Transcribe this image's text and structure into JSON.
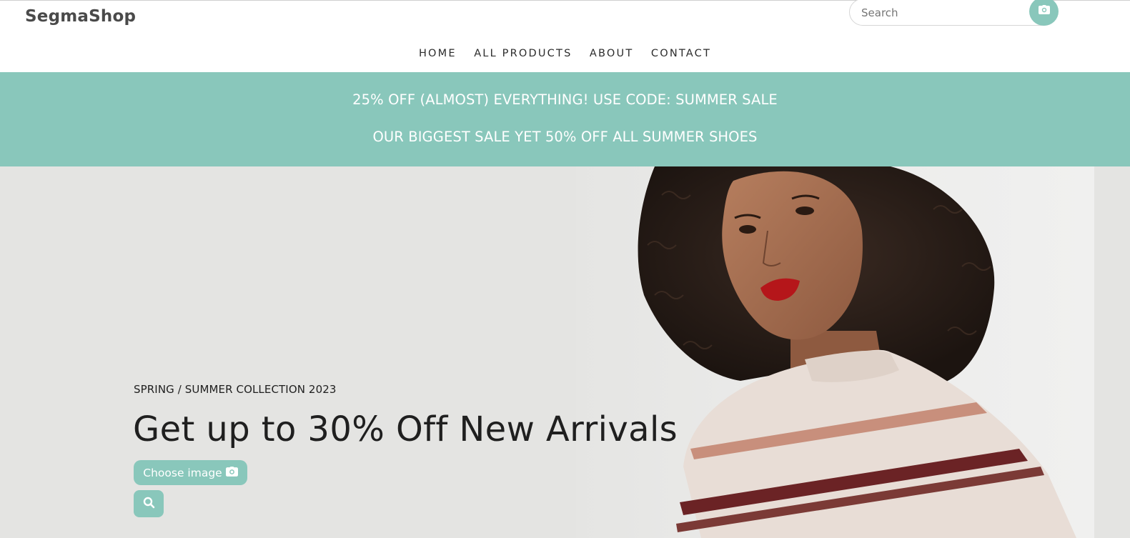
{
  "brand": {
    "name": "SegmaShop"
  },
  "search": {
    "placeholder": "Search",
    "value": ""
  },
  "icons": {
    "camera": "camera-icon",
    "search": "search-icon"
  },
  "colors": {
    "accent": "#89c7bb",
    "hero_bg": "#e4e4e2",
    "text": "#1f1f1f"
  },
  "nav": {
    "items": [
      {
        "label": "HOME"
      },
      {
        "label": "ALL PRODUCTS"
      },
      {
        "label": "ABOUT"
      },
      {
        "label": "CONTACT"
      }
    ]
  },
  "promo": {
    "line1": "25% OFF (ALMOST) EVERYTHING! USE CODE: SUMMER SALE",
    "line2": "OUR BIGGEST SALE YET 50% OFF ALL SUMMER SHOES"
  },
  "hero": {
    "eyebrow": "SPRING / SUMMER COLLECTION 2023",
    "title": "Get up to 30% Off New Arrivals",
    "choose_label": "Choose image"
  }
}
